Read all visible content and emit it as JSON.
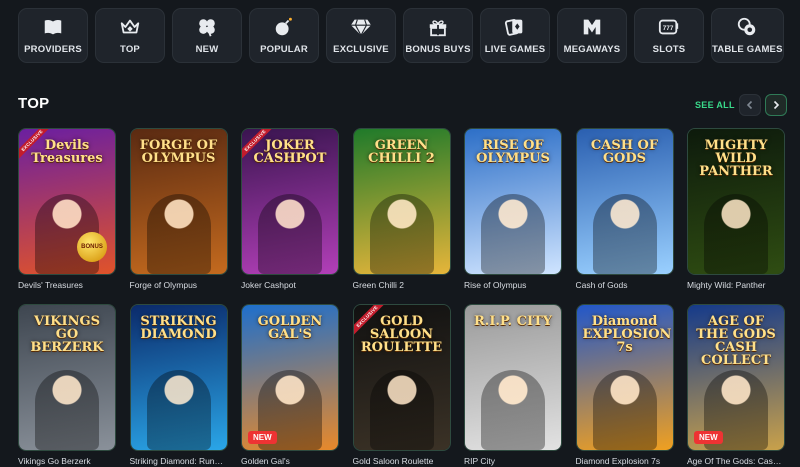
{
  "categories": [
    {
      "label": "PROVIDERS",
      "icon": "book-icon"
    },
    {
      "label": "TOP",
      "icon": "crown-icon"
    },
    {
      "label": "NEW",
      "icon": "clover-icon"
    },
    {
      "label": "POPULAR",
      "icon": "bomb-icon"
    },
    {
      "label": "EXCLUSIVE",
      "icon": "diamond-icon"
    },
    {
      "label": "BONUS BUYS",
      "icon": "gift-icon"
    },
    {
      "label": "LIVE GAMES",
      "icon": "cards-icon"
    },
    {
      "label": "MEGAWAYS",
      "icon": "megaways-icon"
    },
    {
      "label": "SLOTS",
      "icon": "slot-machine-icon"
    },
    {
      "label": "TABLE GAMES",
      "icon": "chips-icon"
    }
  ],
  "section": {
    "title": "TOP",
    "see_all": "SEE ALL"
  },
  "games": [
    {
      "name": "Devils' Treasures",
      "logo": "Devils Treasures",
      "badge": "BONUS",
      "exclusive": "EXCLUSIVE",
      "bg": [
        "#6b1fa0",
        "#e0532a"
      ]
    },
    {
      "name": "Forge of Olympus",
      "logo": "FORGE OF OLYMPUS",
      "bg": [
        "#5a2a12",
        "#c46a1e"
      ]
    },
    {
      "name": "Joker Cashpot",
      "logo": "JOKER CASHPOT",
      "exclusive": "EXCLUSIVE",
      "bg": [
        "#3a1550",
        "#b23fb8"
      ]
    },
    {
      "name": "Green Chilli 2",
      "logo": "GREEN CHILLI 2",
      "bg": [
        "#1f7a2a",
        "#e6b53a"
      ]
    },
    {
      "name": "Rise of Olympus",
      "logo": "RISE OF OLYMPUS",
      "bg": [
        "#2d6fc7",
        "#cfe4ff"
      ]
    },
    {
      "name": "Cash of Gods",
      "logo": "CASH OF GODS",
      "bg": [
        "#2a5fb0",
        "#9ad0ff"
      ]
    },
    {
      "name": "Mighty Wild: Panther",
      "logo": "MIGHTY WILD PANTHER",
      "bg": [
        "#0d1a0c",
        "#2f4d12"
      ]
    },
    {
      "name": "Vikings Go Berzerk",
      "logo": "VIKINGS GO BERZERK",
      "bg": [
        "#3e4650",
        "#8a919a"
      ]
    },
    {
      "name": "Striking Diamond: Running Wins",
      "logo": "STRIKING DIAMOND",
      "bg": [
        "#0b2a6a",
        "#2aa6e8"
      ]
    },
    {
      "name": "Golden Gal's",
      "logo": "GOLDEN GAL'S",
      "badge_new": "NEW",
      "bg": [
        "#1e6fcc",
        "#e8892a"
      ]
    },
    {
      "name": "Gold Saloon Roulette",
      "logo": "GOLD SALOON ROULETTE",
      "exclusive": "EXCLUSIVE",
      "bg": [
        "#111111",
        "#3b3226"
      ]
    },
    {
      "name": "RIP City",
      "logo": "R.I.P. CITY",
      "bg": [
        "#9a9a9a",
        "#e2e2e2"
      ]
    },
    {
      "name": "Diamond Explosion 7s",
      "logo": "Diamond EXPLOSION 7s",
      "bg": [
        "#2257c9",
        "#f0a020"
      ]
    },
    {
      "name": "Age Of The Gods: Cash Collect",
      "logo": "AGE OF THE GODS CASH COLLECT",
      "badge_new": "NEW",
      "bg": [
        "#153a8a",
        "#c9a14a"
      ]
    }
  ]
}
